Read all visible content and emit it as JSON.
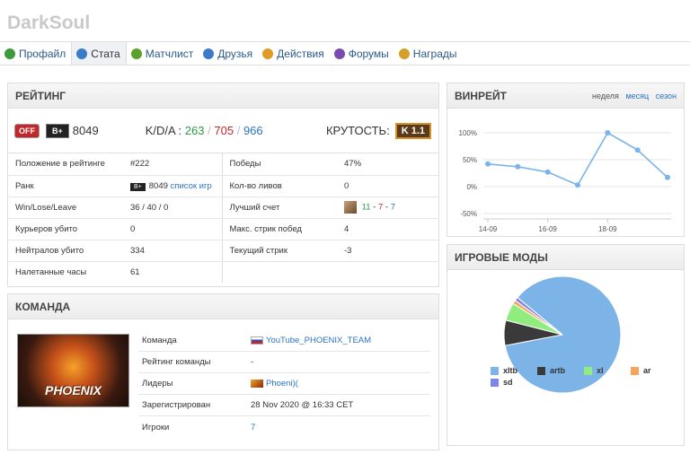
{
  "page_title": "DarkSoul",
  "nav": [
    {
      "label": "Профайл",
      "color": "#3a9b3a"
    },
    {
      "label": "Стата",
      "color": "#3a7bc8"
    },
    {
      "label": "Матчлист",
      "color": "#5aa02a"
    },
    {
      "label": "Друзья",
      "color": "#3a7bc8"
    },
    {
      "label": "Действия",
      "color": "#e09a2a"
    },
    {
      "label": "Форумы",
      "color": "#7a4ab0"
    },
    {
      "label": "Награды",
      "color": "#d5a02a"
    }
  ],
  "rating": {
    "title": "РЕЙТИНГ",
    "off": "OFF",
    "rank_badge": "B+",
    "rank_value": "8049",
    "kda_label": "K/D/A :",
    "kills": "263",
    "deaths": "705",
    "assists": "966",
    "coolness_label": "КРУТОСТЬ:",
    "coolness_badge": "K 1.1",
    "rows": [
      [
        "Положение в рейтинге",
        "#222",
        "Победы",
        "47%"
      ],
      [
        "Ранк",
        "8049",
        "Кол-во ливов",
        "0"
      ],
      [
        "Win/Lose/Leave",
        "36 / 40 / 0",
        "Лучший счет",
        ""
      ],
      [
        "Курьеров убито",
        "0",
        "Макс. стрик побед",
        "4"
      ],
      [
        "Нейтралов убито",
        "334",
        "Текущий стрик",
        "-3"
      ],
      [
        "Налетанные часы",
        "61",
        "",
        ""
      ]
    ],
    "rank_link": "список игр",
    "rank_mini": "B+",
    "best_score": {
      "k": "11",
      "d": "7",
      "a": "7"
    }
  },
  "team": {
    "title": "КОМАНДА",
    "logo_text": "PHOENIX",
    "rows": [
      {
        "label": "Команда",
        "value": "YouTube_PHOENIX_TEAM"
      },
      {
        "label": "Рейтинг команды",
        "value": "-"
      },
      {
        "label": "Лидеры",
        "value": "Phoeni)("
      },
      {
        "label": "Зарегистрирован",
        "value": "28 Nov 2020 @ 16:33 CET"
      },
      {
        "label": "Игроки",
        "value": "7"
      }
    ]
  },
  "winrate": {
    "title": "ВИНРЕЙТ",
    "periods": [
      "неделя",
      "месяц",
      "сезон"
    ]
  },
  "chart_data": [
    {
      "type": "line",
      "x": [
        "13-09",
        "14-09",
        "15-09",
        "16-09",
        "17-09",
        "18-09",
        "19-09",
        "20-09"
      ],
      "xticks": [
        "14-09",
        "16-09",
        "18-09"
      ],
      "values": [
        42,
        37,
        27,
        3,
        100,
        68,
        17
      ],
      "yticks": [
        "100%",
        "50%",
        "0%",
        "-50%"
      ],
      "ylim": [
        -50,
        100
      ],
      "color": "#7cb4e8"
    },
    {
      "type": "pie",
      "title": "ИГРОВЫЕ МОДЫ",
      "labels": [
        "xltb",
        "artb",
        "xl",
        "ar",
        "sd"
      ],
      "values": [
        86,
        7,
        5,
        1,
        1
      ],
      "colors": [
        "#7cb4e8",
        "#3a3a3a",
        "#90ed7d",
        "#f7a35c",
        "#8085e9"
      ]
    }
  ]
}
